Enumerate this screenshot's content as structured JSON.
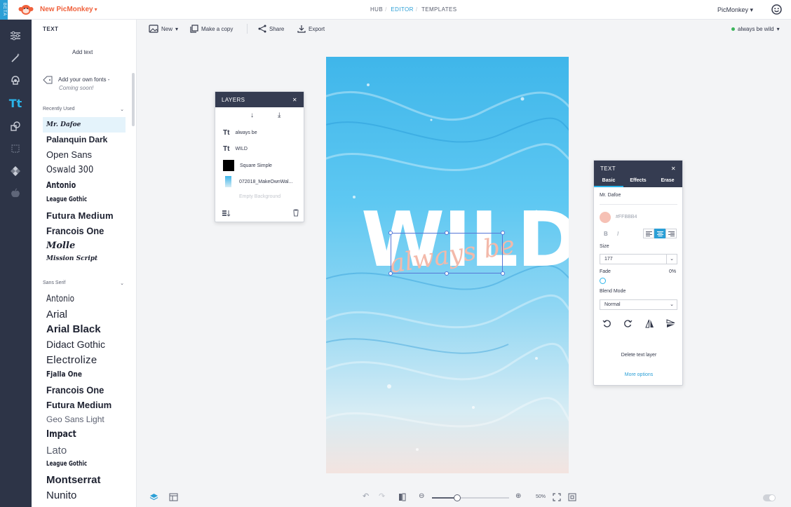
{
  "header": {
    "app_name": "New PicMonkey",
    "beta_label": "BETA",
    "nav": [
      "HUB",
      "EDITOR",
      "TEMPLATES"
    ],
    "account": "PicMonkey"
  },
  "toolbar": {
    "new_label": "New",
    "copy_label": "Make a copy",
    "share_label": "Share",
    "export_label": "Export",
    "project_name": "always be wild"
  },
  "panel": {
    "title": "TEXT",
    "add_text": "Add text",
    "own_fonts_line1": "Add your own fonts -",
    "own_fonts_line2": "Coming soon!",
    "recently_used_label": "Recently Used",
    "recent_fonts": [
      "Mr. Dafoe",
      "Palanquin Dark",
      "Open Sans",
      "Oswald 300",
      "Antonio",
      "League Gothic",
      "Futura Medium",
      "Francois One",
      "Molle",
      "Mission Script"
    ],
    "sans_serif_label": "Sans Serif",
    "sans_fonts": [
      "Antonio",
      "Arial",
      "Arial Black",
      "Didact Gothic",
      "Electrolize",
      "Fjalla One",
      "Francois One",
      "Futura Medium",
      "Geo Sans Light",
      "Impact",
      "Lato",
      "League Gothic",
      "Montserrat",
      "Nunito"
    ]
  },
  "canvas": {
    "main_text": "WILD",
    "script_text": "always be"
  },
  "layers_panel": {
    "title": "LAYERS",
    "layers": [
      "always be",
      "WILD",
      "Square Simple",
      "072018_MakeOwnWal...",
      "Empty Background"
    ]
  },
  "text_panel": {
    "title": "TEXT",
    "tabs": [
      "Basic",
      "Effects",
      "Erase"
    ],
    "font_name": "Mr. Dafoe",
    "color_hex": "#FFBBB4",
    "bold_label": "B",
    "italic_label": "I",
    "size_label": "Size",
    "size_value": "177",
    "fade_label": "Fade",
    "fade_value": "0%",
    "blend_label": "Blend Mode",
    "blend_value": "Normal",
    "delete_label": "Delete text layer",
    "more_label": "More options"
  },
  "zoom": {
    "value": "50%",
    "level": 0.33
  },
  "colors": {
    "accent": "#2b9fd6",
    "brand": "#f0613c",
    "rail": "#2d3447",
    "text_color": "#FFBBB4"
  }
}
